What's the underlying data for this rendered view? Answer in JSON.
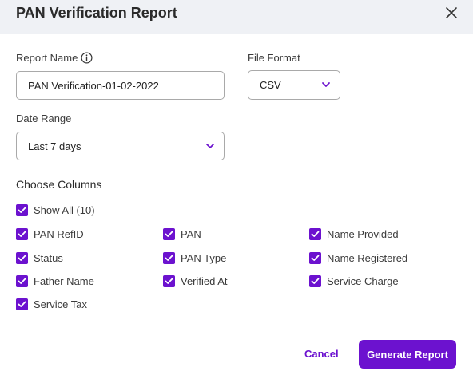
{
  "dialog": {
    "title": "PAN Verification Report"
  },
  "form": {
    "report_name_label": "Report Name",
    "report_name_value": "PAN Verification-01-02-2022",
    "file_format_label": "File Format",
    "file_format_value": "CSV",
    "date_range_label": "Date Range",
    "date_range_value": "Last 7 days"
  },
  "columns": {
    "title": "Choose Columns",
    "show_all": {
      "label": "Show All (10)",
      "checked": true
    },
    "items": [
      {
        "label": "PAN RefID",
        "checked": true
      },
      {
        "label": "PAN",
        "checked": true
      },
      {
        "label": "Name Provided",
        "checked": true
      },
      {
        "label": "Status",
        "checked": true
      },
      {
        "label": "PAN Type",
        "checked": true
      },
      {
        "label": "Name Registered",
        "checked": true
      },
      {
        "label": "Father Name",
        "checked": true
      },
      {
        "label": "Verified At",
        "checked": true
      },
      {
        "label": "Service Charge",
        "checked": true
      },
      {
        "label": "Service Tax",
        "checked": true
      }
    ]
  },
  "actions": {
    "cancel_label": "Cancel",
    "generate_label": "Generate Report"
  },
  "colors": {
    "accent": "#6c12cf",
    "header_bg": "#eff1f5"
  }
}
